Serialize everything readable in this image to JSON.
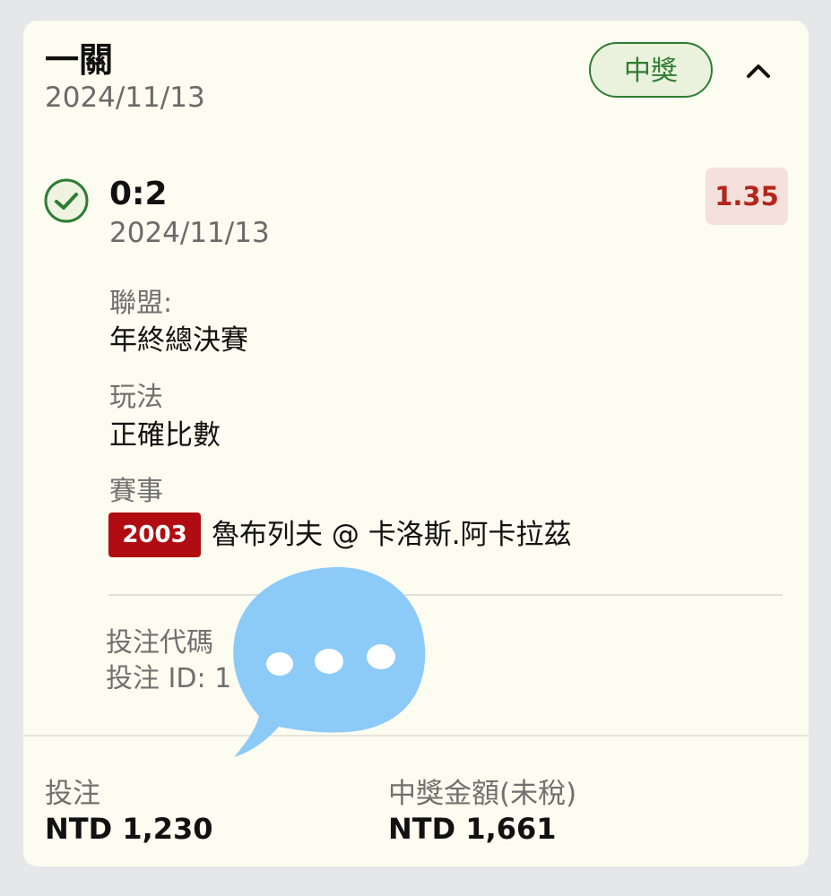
{
  "header": {
    "bet_type": "一關",
    "date": "2024/11/13",
    "status": "中獎"
  },
  "selection": {
    "score": "0:2",
    "date": "2024/11/13",
    "odds": "1.35",
    "league_label": "聯盟:",
    "league_value": "年終總決賽",
    "play_label": "玩法",
    "play_value": "正確比數",
    "event_label": "賽事",
    "event_code": "2003",
    "event_name": "魯布列夫 @ 卡洛斯.阿卡拉茲"
  },
  "bet_info": {
    "code_label": "投注代碼",
    "id_label": "投注 ID: 1"
  },
  "footer": {
    "stake_label": "投注",
    "stake_value": "NTD 1,230",
    "payout_label": "中獎金額(未稅)",
    "payout_value": "NTD 1,661"
  },
  "icons": {
    "check": "check-circle-icon",
    "collapse": "chevron-up-icon",
    "overlay": "chat-bubble-icon"
  },
  "colors": {
    "win_green": "#2e7d32",
    "odds_red": "#b3261e",
    "event_badge": "#b00c12",
    "overlay_blue": "#8ccaf8"
  }
}
